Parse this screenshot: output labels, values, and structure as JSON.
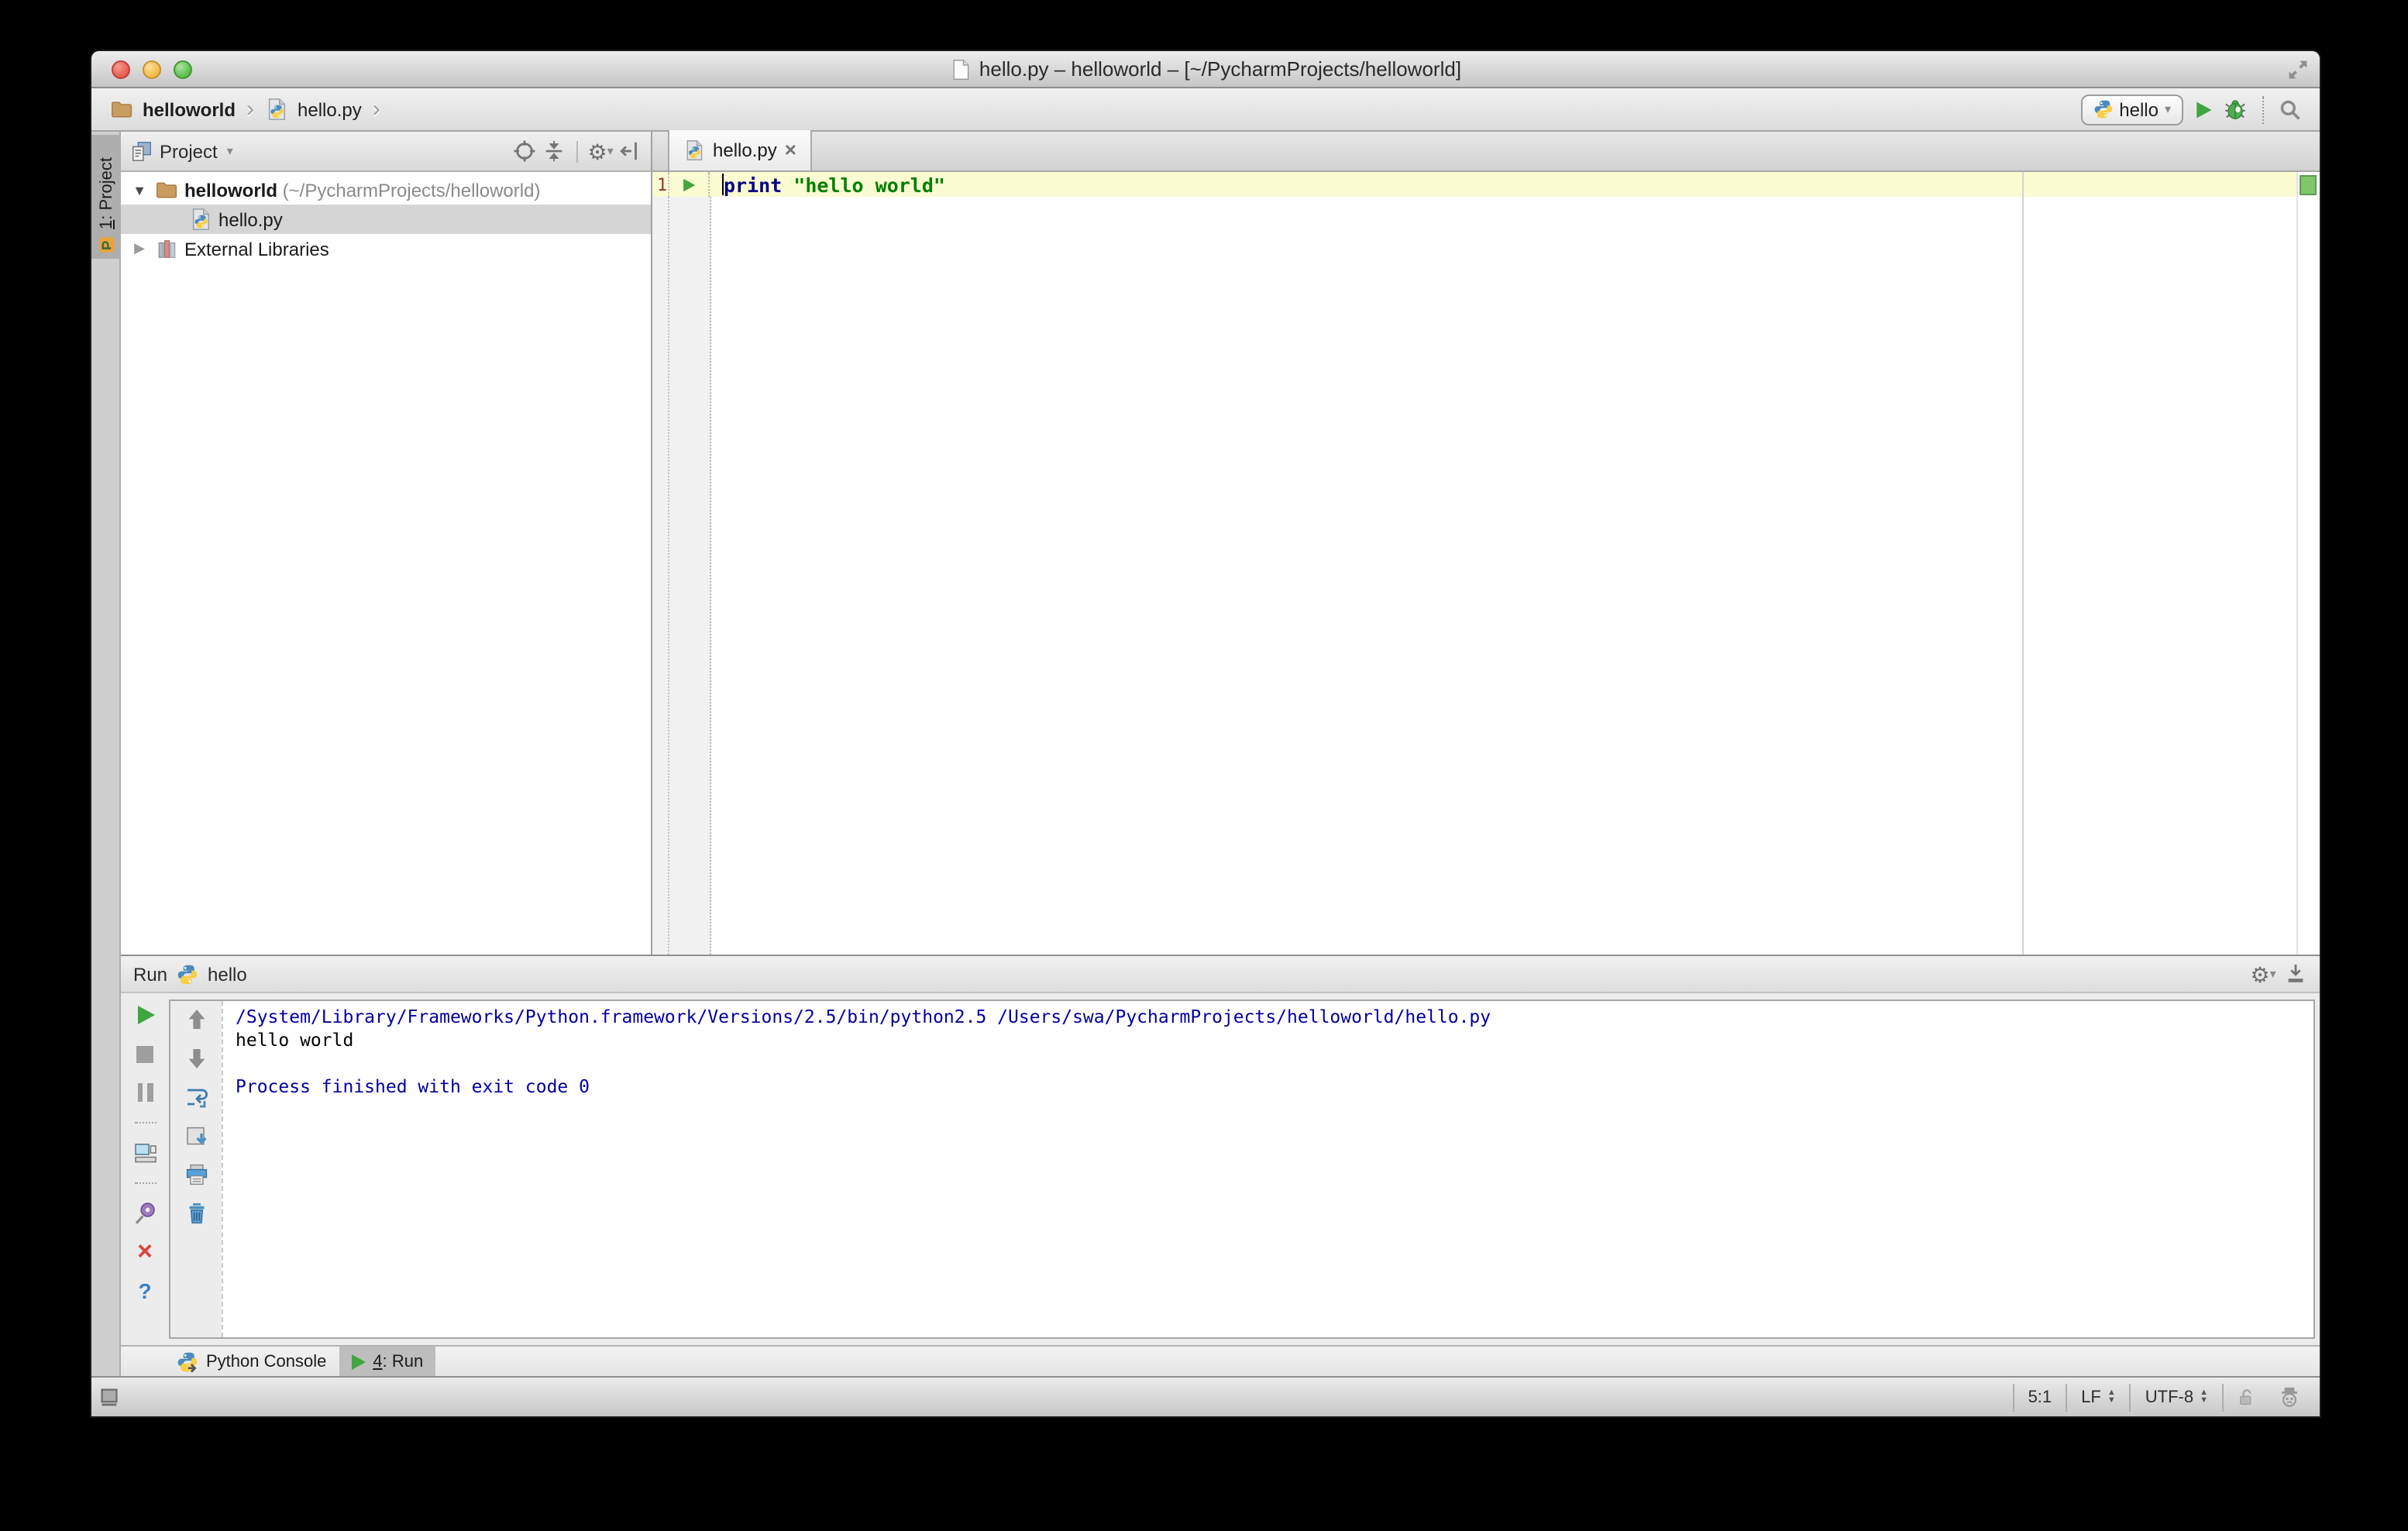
{
  "window": {
    "title": "hello.py – helloworld – [~/PycharmProjects/helloworld]"
  },
  "navbar": {
    "breadcrumbs": [
      {
        "label": "helloworld"
      },
      {
        "label": "hello.py"
      }
    ],
    "run_config": "hello"
  },
  "tool_strip": {
    "project_tab": {
      "number": "1",
      "label": ": Project"
    }
  },
  "project_panel": {
    "header": {
      "title": "Project"
    },
    "tree": [
      {
        "name": "helloworld",
        "path": " (~/PycharmProjects/helloworld)"
      },
      {
        "name": "hello.py"
      },
      {
        "name": "External Libraries"
      }
    ]
  },
  "editor": {
    "tab": "hello.py",
    "line_number": "1",
    "code": {
      "keyword": "print",
      "string": "\"hello world\""
    }
  },
  "run_panel": {
    "title": "Run",
    "config": "hello",
    "console": [
      "/System/Library/Frameworks/Python.framework/Versions/2.5/bin/python2.5 /Users/swa/PycharmProjects/helloworld/hello.py",
      "hello world",
      "",
      "Process finished with exit code 0"
    ]
  },
  "tool_window_bar": {
    "python_console": "Python Console",
    "run_tab": {
      "number": "4",
      "label": ": Run"
    }
  },
  "status_bar": {
    "position": "5:1",
    "line_separator": "LF",
    "encoding": "UTF-8"
  },
  "icons": {
    "expand-open": "▼",
    "expand-closed": "▶",
    "combo-chevron": "▾",
    "breadcrumb-chevron": "›",
    "close-tab": "×",
    "close-panel": "×",
    "help": "?",
    "gear": "⚙"
  },
  "colors": {
    "keyword": "#000080",
    "string": "#008000",
    "console_info": "#0000A0",
    "current_line": "#FBFBD2",
    "selection": "#D5D5D5",
    "run_green": "#3FA640",
    "inspection_ok": "#7FC768",
    "line_number": "#8F3A30"
  }
}
